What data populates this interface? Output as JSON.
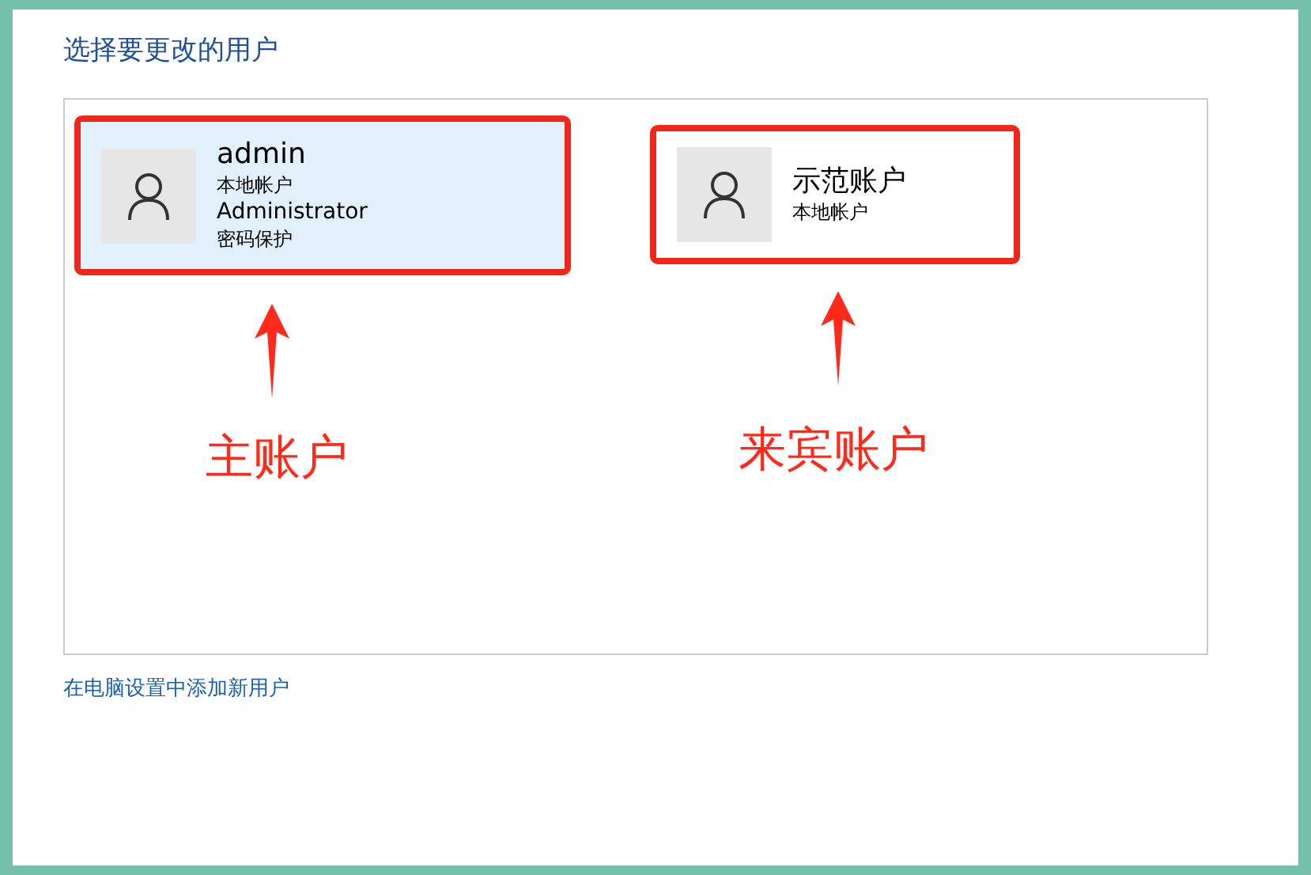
{
  "title": "选择要更改的用户",
  "users": [
    {
      "name": "admin",
      "details": [
        "本地帐户",
        "Administrator",
        "密码保护"
      ],
      "selected": true,
      "annotation": "主账户"
    },
    {
      "name": "示范账户",
      "details": [
        "本地帐户"
      ],
      "selected": false,
      "annotation": "来宾账户"
    }
  ],
  "link": "在电脑设置中添加新用户"
}
